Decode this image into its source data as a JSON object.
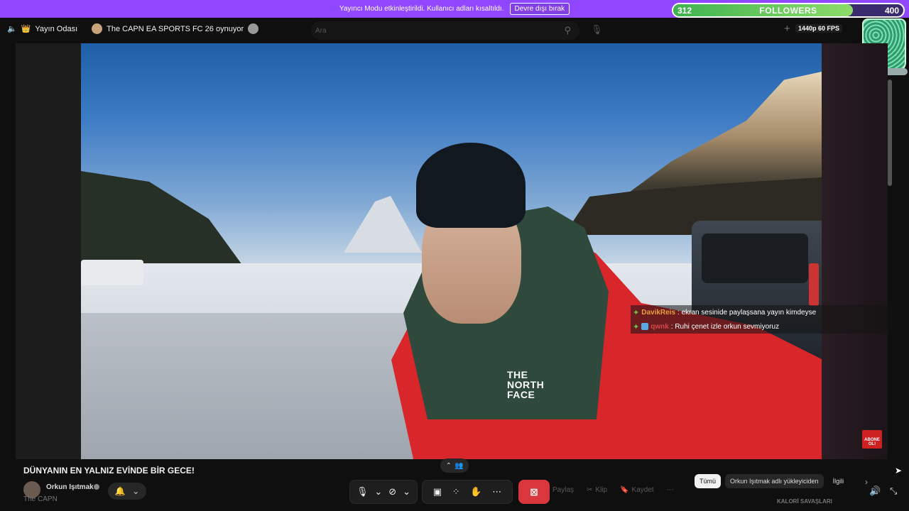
{
  "banner": {
    "message": "Yayıncı Modu etkinleştirildi. Kullanıcı adları kısaltıldı.",
    "disable_label": "Devre dışı bırak"
  },
  "followers_goal": {
    "current": "312",
    "label": "FOLLOWERS",
    "target": "400",
    "progress_percent": 78,
    "fill_color": "#4cbf55"
  },
  "header": {
    "room_label": "Yayın Odası",
    "now_playing": "The CAPN EA SPORTS FC 26 oynuyor",
    "search_placeholder": "Ara",
    "quality": "1440p 60 FPS"
  },
  "video": {
    "brand_text": "THE NORTH FACE"
  },
  "chat": [
    {
      "user": "DavikReis",
      "message": ": ekran sesinide paylaşsana yayın kimdeyse"
    },
    {
      "user": "qwnk",
      "message": ": Ruhi çenet izle orkun sevmiyoruz"
    }
  ],
  "subscribe_badge": "ABONE OL!",
  "video_title": "DÜNYANIN EN YALNIZ EVİNDE BİR GECE!",
  "channel": {
    "name": "Orkun Işıtmak",
    "subtext": "The CAPN"
  },
  "actions": {
    "share": "Paylaş",
    "clip": "Klip",
    "save": "Kaydet"
  },
  "chips": [
    "Tümü",
    "Orkun Işıtmak adlı yükleyiciden",
    "İlgili"
  ],
  "bottom_right_text": "KALORİ SAVAŞLARI",
  "colors": {
    "banner": "#9147ff",
    "end_button": "#d9363e"
  }
}
